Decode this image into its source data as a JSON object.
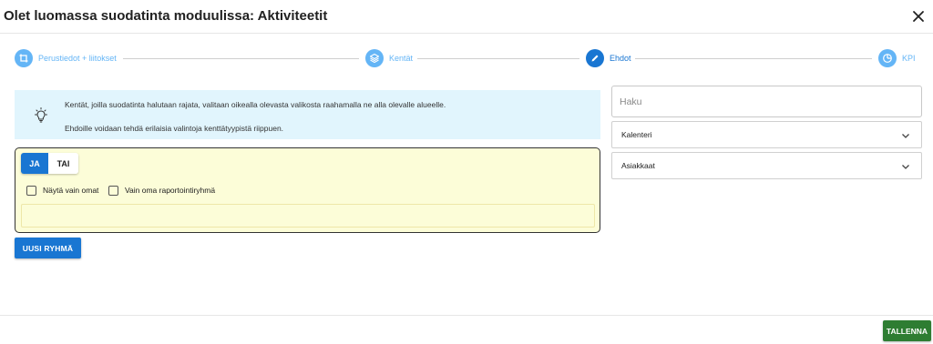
{
  "dialog": {
    "title": "Olet luomassa suodatinta moduulissa: Aktiviteetit",
    "close_icon": "close-icon"
  },
  "stepper": {
    "steps": [
      {
        "label": "Perustiedot + liitokset",
        "icon": "crop-icon",
        "state": "inactive"
      },
      {
        "label": "Kentät",
        "icon": "layers-icon",
        "state": "inactive"
      },
      {
        "label": "Ehdot",
        "icon": "pencil-icon",
        "state": "active"
      },
      {
        "label": "KPI",
        "icon": "pie-chart-icon",
        "state": "inactive"
      }
    ],
    "colors": {
      "active": "#1976d2",
      "inactive": "#64b5f6"
    }
  },
  "info": {
    "icon": "lightbulb-icon",
    "line1": "Kentät, joilla suodatinta halutaan rajata, valitaan oikealla olevasta valikosta raahamalla ne alla olevalle alueelle.",
    "line2": "Ehdoille voidaan tehdä erilaisia valintoja kenttätyypistä riippuen."
  },
  "group": {
    "toggle": {
      "and_label": "JA",
      "or_label": "TAI",
      "selected": "JA"
    },
    "checkboxes": [
      {
        "label": "Näytä vain omat",
        "checked": false
      },
      {
        "label": "Vain oma raportointiryhmä",
        "checked": false
      }
    ]
  },
  "new_group_button": {
    "label": "UUSI RYHMÄ"
  },
  "sidebar": {
    "search": {
      "placeholder": "Haku",
      "value": ""
    },
    "sections": [
      {
        "label": "Kalenteri",
        "icon": "chevron-down-icon"
      },
      {
        "label": "Asiakkaat",
        "icon": "chevron-down-icon"
      }
    ]
  },
  "footer": {
    "save_label": "TALLENNA"
  },
  "colors": {
    "primary": "#1976d2",
    "save": "#2e7d32",
    "info_background": "#e1f5fd",
    "group_background": "#fcfdd8"
  }
}
